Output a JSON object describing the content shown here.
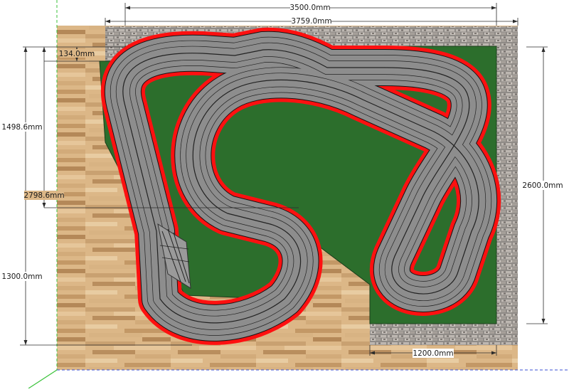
{
  "colors": {
    "background": "#ffffff",
    "floor_light": "#dcb787",
    "floor_dark": "#b98e5e",
    "wall": "#8f8b87",
    "baseboard": "#2c6e2c",
    "track_surface": "#8d8d8d",
    "track_border": "#ff1010",
    "lane_line": "#1e1e1e",
    "dimension_line": "#2b2b2b",
    "axis_green": "#38c238",
    "axis_blue": "#3a4fd6"
  },
  "dimensions": {
    "top_width": "3500.0mm",
    "overall_width": "3759.0mm",
    "top_offset": "134.0mm",
    "left_upper": "1498.6mm",
    "left_total": "2798.6mm",
    "left_lower": "1300.0mm",
    "right_height": "2600.0mm",
    "bottom_width": "1200.0mm"
  }
}
